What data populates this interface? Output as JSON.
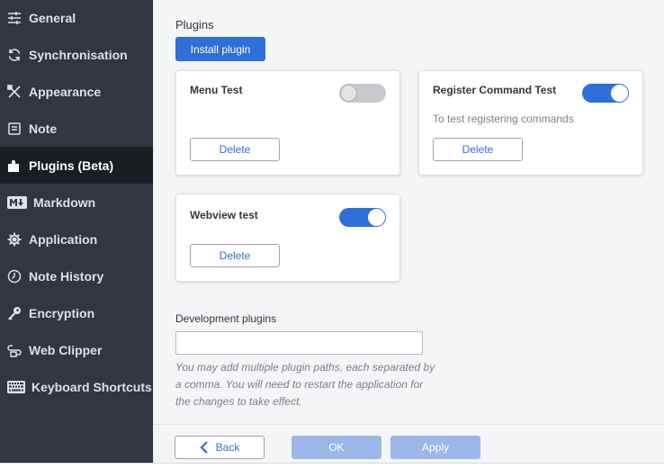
{
  "sidebar": {
    "items": [
      {
        "label": "General",
        "icon": "sliders-icon",
        "active": false
      },
      {
        "label": "Synchronisation",
        "icon": "sync-icon",
        "active": false
      },
      {
        "label": "Appearance",
        "icon": "paint-tools-icon",
        "active": false
      },
      {
        "label": "Note",
        "icon": "note-icon",
        "active": false
      },
      {
        "label": "Plugins (Beta)",
        "icon": "puzzle-icon",
        "active": true
      },
      {
        "label": "Markdown",
        "icon": "markdown-icon",
        "active": false
      },
      {
        "label": "Application",
        "icon": "gear-icon",
        "active": false
      },
      {
        "label": "Note History",
        "icon": "history-icon",
        "active": false
      },
      {
        "label": "Encryption",
        "icon": "key-icon",
        "active": false
      },
      {
        "label": "Web Clipper",
        "icon": "clipper-icon",
        "active": false
      },
      {
        "label": "Keyboard Shortcuts",
        "icon": "keyboard-icon",
        "active": false
      }
    ]
  },
  "main": {
    "section_title": "Plugins",
    "install_label": "Install plugin",
    "plugins": [
      {
        "name": "Menu Test",
        "description": "",
        "enabled": false,
        "delete_label": "Delete"
      },
      {
        "name": "Register Command Test",
        "description": "To test registering commands",
        "enabled": true,
        "delete_label": "Delete"
      },
      {
        "name": "Webview test",
        "description": "",
        "enabled": true,
        "delete_label": "Delete"
      }
    ],
    "dev_label": "Development plugins",
    "dev_value": "",
    "dev_help": "You may add multiple plugin paths, each separated by a comma. You will need to restart the application for the changes to take effect."
  },
  "footer": {
    "back_label": "Back",
    "ok_label": "OK",
    "apply_label": "Apply"
  },
  "colors": {
    "accent": "#2e6fd9",
    "sidebar_bg": "#313640",
    "sidebar_active_bg": "#1a1d22",
    "main_bg": "#f4f5f6",
    "disabled_button": "#9bb7e8"
  }
}
